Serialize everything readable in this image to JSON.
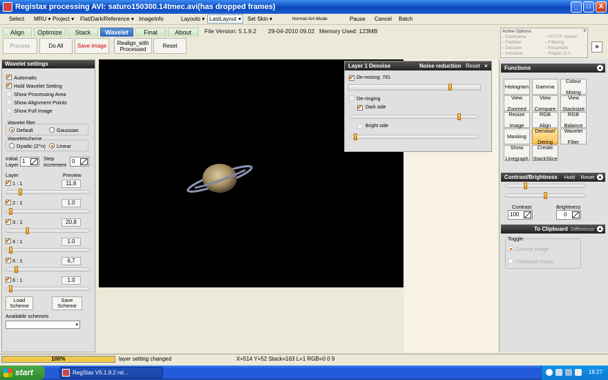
{
  "window": {
    "title": "Registax processing AVI: saturo150300.14tmec.avi(has dropped frames)",
    "minimize": "_",
    "maximize": "□",
    "close": "X"
  },
  "menu": {
    "select": "Select",
    "mru": "MRU",
    "project": "Project",
    "flat": "Flat/Dark/Reference",
    "imageinfo": "ImageInfo",
    "layouts": "Layouts",
    "layout_value": "LastLayout",
    "set_skin": "Set Skin",
    "normal_avi_mode": "Normal AVI-Mode",
    "pause": "Pause",
    "cancel": "Cancel",
    "batch": "Batch"
  },
  "tabs": [
    "Align",
    "Optimize",
    "Stack",
    "Wavelet",
    "Final",
    "About"
  ],
  "info": {
    "file_version": "File Version: 5.1.9.2",
    "date": "29-04-2010 09.02",
    "memory": "Memory Used: 123MB"
  },
  "toolbar": {
    "process": "Process",
    "do_all": "Do All",
    "save_image": "Save image",
    "realign_1": "Realign_with",
    "realign_2": "Processed",
    "reset": "Reset"
  },
  "active_options": {
    "title": "Active Options",
    "items": [
      "Darkframe",
      "Flatfield",
      "Debayer",
      "Interlace",
      "FIT/TIF stretch",
      "Filtering",
      "Resample",
      "Region O.I."
    ],
    "expand": "»"
  },
  "wavelet": {
    "header": "Wavelet settings",
    "automatic": "Automatic",
    "hold": "Hold Wavelet Setting",
    "show_processing_area": "Show Processing Area",
    "show_alignment_points": "Show Alignment Points",
    "show_full_image": "Show Full Image",
    "filter_label": "Wavelet filter",
    "filter_default": "Default",
    "filter_gaussian": "Gaussian",
    "scheme_label": "Waveletscheme",
    "scheme_dyadic": "Dyadic (2^n)",
    "scheme_linear": "Linear",
    "initial_layer_1": "Initial",
    "initial_layer_2": "Layer",
    "initial_value": "1",
    "step_1": "Step",
    "step_2": "increment",
    "step_value": "0",
    "layer_head": "Layer",
    "preview_head": "Preview",
    "layers": [
      {
        "name": "1 : 1",
        "value": "11,6"
      },
      {
        "name": "2 : 1",
        "value": "1.0"
      },
      {
        "name": "3 : 1",
        "value": "20,8"
      },
      {
        "name": "4 : 1",
        "value": "1.0"
      },
      {
        "name": "5 : 1",
        "value": "6,7"
      },
      {
        "name": "6 : 1",
        "value": "1.0"
      }
    ],
    "load_1": "Load",
    "load_2": "Scheme",
    "save_1": "Save",
    "save_2": "Scheme",
    "available": "Available schemes"
  },
  "denoise": {
    "title": "Layer 1 Denoise",
    "noise_reduction": "Noise reduction",
    "reset": "Reset",
    "close": "×",
    "denoising": "De-noising: 781",
    "deringing": "De-ringing",
    "dark_side": "Dark side",
    "bright_side": "Bright side"
  },
  "functions": {
    "header": "Functions",
    "buttons": [
      [
        "Histogram"
      ],
      [
        "Gamma"
      ],
      [
        "Colour",
        "Mixing"
      ],
      [
        "View",
        "Zoomed"
      ],
      [
        "View",
        "Compare"
      ],
      [
        "View",
        "Stacksize"
      ],
      [
        "Resize",
        "Image"
      ],
      [
        "RGB",
        "Align"
      ],
      [
        "RGB",
        "Balance"
      ],
      [
        "Masking"
      ],
      [
        "Denoise/",
        "Dering"
      ],
      [
        "Wavelet",
        "Filter"
      ],
      [
        "Show",
        "Linegraph"
      ],
      [
        "Create",
        "StackSlice"
      ]
    ]
  },
  "contrast": {
    "header": "Contrast/Brightness",
    "hold": "Hold",
    "reset": "Reset",
    "contrast_label": "Contrast",
    "contrast_value": "100",
    "brightness_label": "Brightness",
    "brightness_value": "0"
  },
  "clipboard": {
    "header": "To Clipboard",
    "difference": "Difference",
    "toggle": "Toggle",
    "current": "Current Image",
    "clipboard": "Clipboard Image"
  },
  "status": {
    "progress_text": "100%",
    "progress_value": 1.0,
    "message": "layer setting changed",
    "coords": "X=514 Y=52 Stack=163 L=1 RGB=0 0 9"
  },
  "taskbar": {
    "start": "start",
    "task": "RegStax V5.1.9.2 rel...",
    "clock": "18.27"
  }
}
